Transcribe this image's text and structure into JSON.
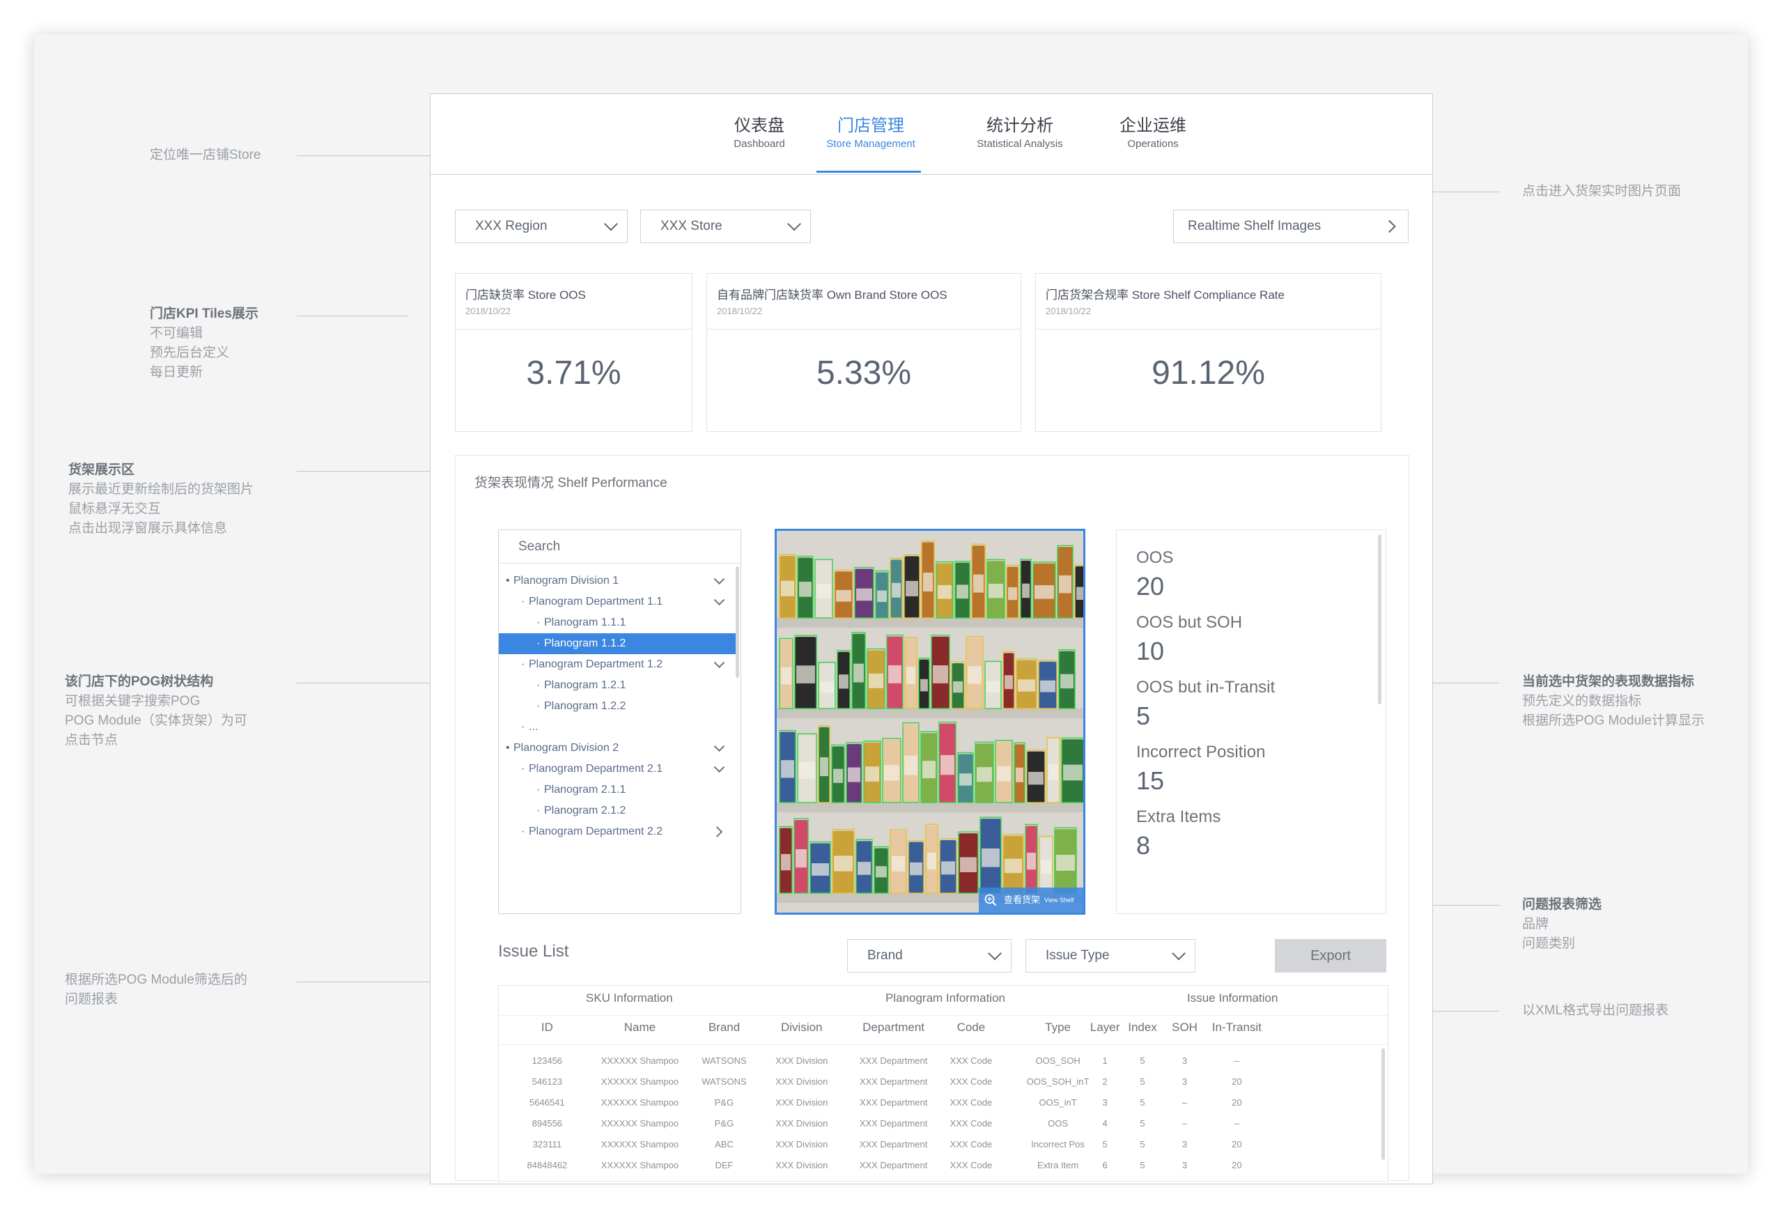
{
  "nav": {
    "tabs": [
      {
        "cn": "仪表盘",
        "en": "Dashboard",
        "active": false
      },
      {
        "cn": "门店管理",
        "en": "Store Management",
        "active": true
      },
      {
        "cn": "统计分析",
        "en": "Statistical Analysis",
        "active": false
      },
      {
        "cn": "企业运维",
        "en": "Operations",
        "active": false
      }
    ]
  },
  "filters": {
    "region": "XXX Region",
    "store": "XXX Store",
    "realtime_button": "Realtime Shelf Images"
  },
  "kpis": [
    {
      "title": "门店缺货率 Store OOS",
      "date": "2018/10/22",
      "value": "3.71%"
    },
    {
      "title": "自有品牌门店缺货率 Own Brand Store OOS",
      "date": "2018/10/22",
      "value": "5.33%"
    },
    {
      "title": "门店货架合规率 Store Shelf Compliance Rate",
      "date": "2018/10/22",
      "value": "91.12%"
    }
  ],
  "shelf_performance": {
    "title": "货架表现情况 Shelf Performance",
    "search_placeholder": "Search",
    "tree": [
      {
        "label": "Planogram Division 1",
        "level": 0,
        "chevron": "down",
        "selected": false
      },
      {
        "label": "Planogram Department 1.1",
        "level": 1,
        "chevron": "down",
        "selected": false
      },
      {
        "label": "Planogram 1.1.1",
        "level": 2,
        "chevron": "",
        "selected": false
      },
      {
        "label": "Planogram 1.1.2",
        "level": 2,
        "chevron": "",
        "selected": true
      },
      {
        "label": "Planogram Department 1.2",
        "level": 1,
        "chevron": "down",
        "selected": false
      },
      {
        "label": "Planogram 1.2.1",
        "level": 2,
        "chevron": "",
        "selected": false
      },
      {
        "label": "Planogram 1.2.2",
        "level": 2,
        "chevron": "",
        "selected": false
      },
      {
        "label": "...",
        "level": 1,
        "chevron": "",
        "selected": false
      },
      {
        "label": "Planogram Division 2",
        "level": 0,
        "chevron": "down",
        "selected": false
      },
      {
        "label": "Planogram Department 2.1",
        "level": 1,
        "chevron": "down",
        "selected": false
      },
      {
        "label": "Planogram 2.1.1",
        "level": 2,
        "chevron": "",
        "selected": false
      },
      {
        "label": "Planogram 2.1.2",
        "level": 2,
        "chevron": "",
        "selected": false
      },
      {
        "label": "Planogram Department 2.2",
        "level": 1,
        "chevron": "right",
        "selected": false
      }
    ],
    "view_shelf_button": "查看货架",
    "view_shelf_button_en": "View Shelf",
    "metrics": [
      {
        "label": "OOS",
        "value": "20"
      },
      {
        "label": "OOS but SOH",
        "value": "10"
      },
      {
        "label": "OOS but in-Transit",
        "value": "5"
      },
      {
        "label": "Incorrect Position",
        "value": "15"
      },
      {
        "label": "Extra Items",
        "value": "8"
      }
    ]
  },
  "issue_list": {
    "title": "Issue List",
    "brand_filter": "Brand",
    "issue_type_filter": "Issue Type",
    "export_button": "Export",
    "groups": [
      "SKU Information",
      "Planogram Information",
      "Issue Information"
    ],
    "columns": [
      "ID",
      "Name",
      "Brand",
      "Division",
      "Department",
      "Code",
      "Type",
      "Layer",
      "Index",
      "SOH",
      "In-Transit"
    ],
    "rows": [
      [
        "123456",
        "XXXXXX Shampoo",
        "WATSONS",
        "XXX Division",
        "XXX Department",
        "XXX Code",
        "OOS_SOH",
        "1",
        "5",
        "3",
        "–"
      ],
      [
        "546123",
        "XXXXXX Shampoo",
        "WATSONS",
        "XXX Division",
        "XXX Department",
        "XXX Code",
        "OOS_SOH_inT",
        "2",
        "5",
        "3",
        "20"
      ],
      [
        "5646541",
        "XXXXXX Shampoo",
        "P&G",
        "XXX Division",
        "XXX Department",
        "XXX Code",
        "OOS_inT",
        "3",
        "5",
        "–",
        "20"
      ],
      [
        "894556",
        "XXXXXX Shampoo",
        "P&G",
        "XXX Division",
        "XXX Department",
        "XXX Code",
        "OOS",
        "4",
        "5",
        "–",
        "–"
      ],
      [
        "323111",
        "XXXXXX Shampoo",
        "ABC",
        "XXX Division",
        "XXX Department",
        "XXX Code",
        "Incorrect Pos",
        "5",
        "5",
        "3",
        "20"
      ],
      [
        "84848462",
        "XXXXXX Shampoo",
        "DEF",
        "XXX Division",
        "XXX Department",
        "XXX Code",
        "Extra Item",
        "6",
        "5",
        "3",
        "20"
      ]
    ]
  },
  "annotations": {
    "store_locate": "定位唯一店铺Store",
    "kpi": [
      "门店KPI Tiles展示",
      "不可编辑",
      "预先后台定义",
      "每日更新"
    ],
    "shelf": [
      "货架展示区",
      "展示最近更新绘制后的货架图片",
      "鼠标悬浮无交互",
      "点击出现浮窗展示具体信息"
    ],
    "tree": [
      "该门店下的POG树状结构",
      "可根据关键字搜索POG",
      "POG Module（实体货架）为可",
      "点击节点"
    ],
    "issue": [
      "根据所选POG Module筛选后的",
      "问题报表"
    ],
    "realtime": "点击进入货架实时图片页面",
    "metrics": [
      "当前选中货架的表现数据指标",
      "预先定义的数据指标",
      "根据所选POG Module计算显示"
    ],
    "filter": [
      "问题报表筛选",
      "品牌",
      "问题类别"
    ],
    "export": "以XML格式导出问题报表"
  },
  "colors": {
    "accent": "#3b86e0",
    "text": "#5b6472",
    "annotation": "#9aa0a8"
  }
}
